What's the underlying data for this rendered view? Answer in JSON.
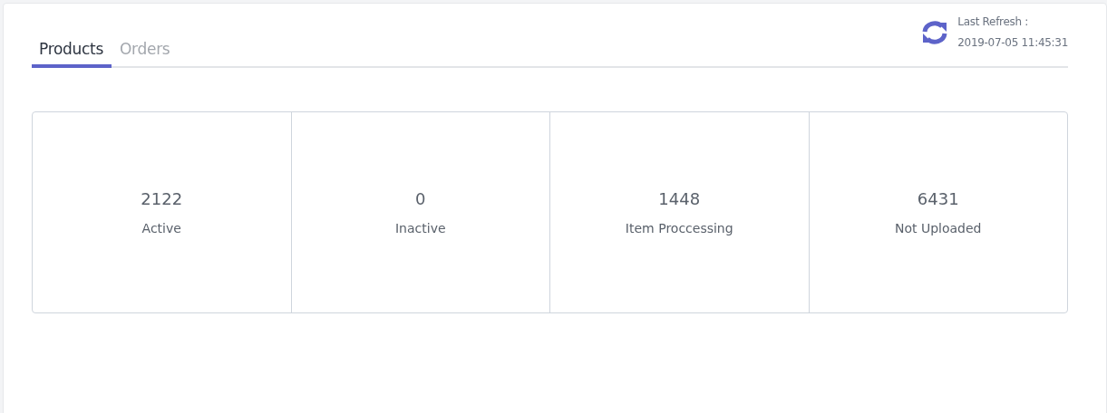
{
  "tabs": [
    {
      "label": "Products",
      "selected": true
    },
    {
      "label": "Orders",
      "selected": false
    }
  ],
  "refresh": {
    "label": "Last Refresh :",
    "time": "2019-07-05 11:45:31"
  },
  "stats": [
    {
      "value": "2122",
      "label": "Active"
    },
    {
      "value": "0",
      "label": "Inactive"
    },
    {
      "value": "1448",
      "label": "Item Proccessing"
    },
    {
      "value": "6431",
      "label": "Not Uploaded"
    }
  ]
}
